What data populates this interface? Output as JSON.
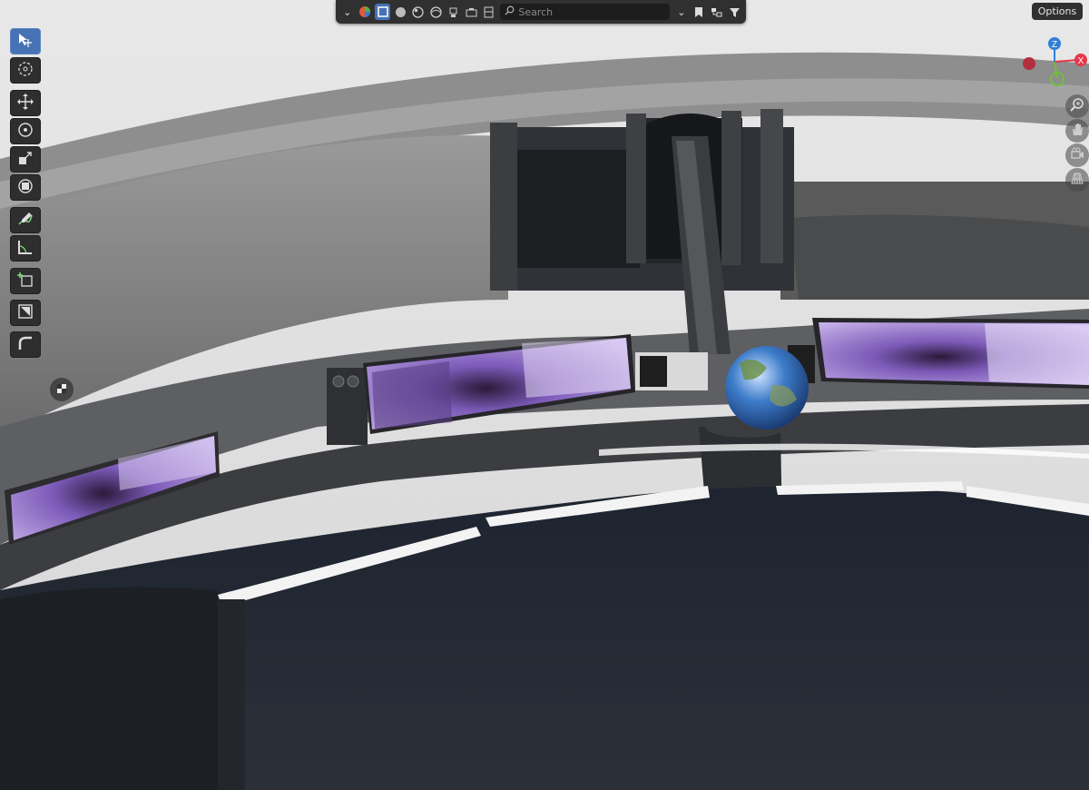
{
  "header": {
    "search": {
      "placeholder": "Search"
    },
    "options_label": "Options",
    "icons": [
      "editor-type-chevron-icon",
      "material-ball-icon",
      "select-box-icon",
      "solid-shading-icon",
      "material-preview-icon",
      "rendered-shading-icon",
      "light-icon",
      "camera-icon",
      "film-icon",
      "search-icon",
      "bookmark-icon",
      "view-layer-icon",
      "filter-icon"
    ]
  },
  "toolbar": {
    "tools": [
      "select-box",
      "cursor",
      "move",
      "rotate",
      "scale",
      "transform",
      "annotate",
      "measure",
      "add-cube",
      "shear",
      "bend"
    ],
    "active": "select-box"
  },
  "navigation": {
    "gizmo": {
      "z_label": "Z",
      "x_label": "X",
      "x_color": "#e5384b",
      "y_color": "#6fbf3a",
      "z_color": "#2f7fd6"
    },
    "buttons": [
      "zoom-icon",
      "hand-pan-icon",
      "camera-view-icon",
      "grid-ortho-icon"
    ]
  },
  "colors": {
    "accent": "#4772b3",
    "header_bg": "#303030",
    "panel_bg": "#2e2e2e",
    "screen_purple": "#9b7ad6"
  }
}
